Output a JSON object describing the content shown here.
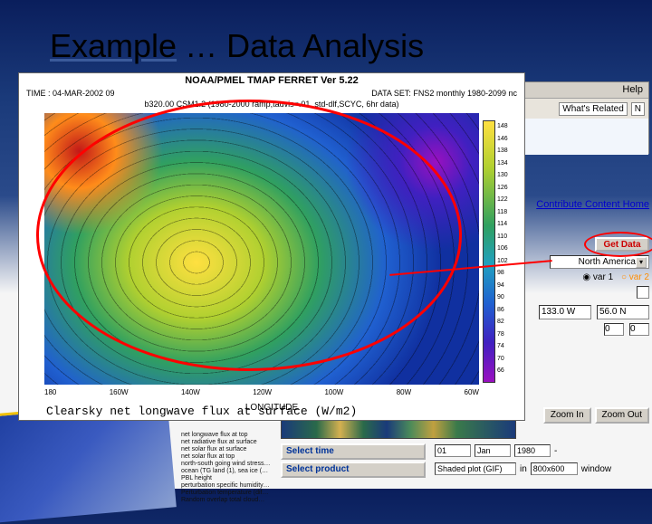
{
  "title_a": "Example",
  "title_b": "… Data Analysis",
  "browser": {
    "help": "Help",
    "related": "What's Related",
    "n": "N"
  },
  "links": {
    "contribute": "Contribute Content",
    "home": "Home"
  },
  "controls": {
    "getdata": "Get Data",
    "region": "North America",
    "var1": "var 1",
    "var2": "var 2",
    "lon": "133.0 W",
    "lat": "56.0 N",
    "box0a": "0",
    "box0b": "0",
    "zoomin": "Zoom In",
    "zoomout": "Zoom Out",
    "seltime": "Select time",
    "selprod": "Select product",
    "t_day": "01",
    "t_mon": "Jan",
    "t_year": "1980",
    "prod": "Shaded plot (GIF)",
    "in": "in",
    "size": "800x600",
    "window": "window"
  },
  "ferret": {
    "header": "NOAA/PMEL TMAP      FERRET Ver 5.22",
    "time": "TIME : 04-MAR-2002 09",
    "dataset": "DATA SET: FNS2 monthly 1980-2099 nc",
    "sub2": "b320.00 CSM1.2 (1980-2000 ramp,tauvis=.01, std-dlf,SCYC, 6hr data)",
    "xlabel": "LONGITUDE",
    "desc": "Clearsky net longwave flux at surface (W/m2)",
    "xticks": [
      "180",
      "160W",
      "140W",
      "120W",
      "100W",
      "80W",
      "60W"
    ],
    "cb": [
      "148",
      "146",
      "138",
      "134",
      "130",
      "126",
      "122",
      "118",
      "114",
      "110",
      "106",
      "102",
      "98",
      "94",
      "90",
      "86",
      "82",
      "78",
      "74",
      "70",
      "66"
    ]
  },
  "varlist": [
    "net longwave flux at top",
    "net radiative flux at surface",
    "net solar flux at surface",
    "net solar flux at top",
    "north-south going wind stress…",
    "ocean (TG land (1), sea ice (…",
    "PBL height",
    "perturbation specific humidity…",
    "Perturbation temperature (dif…",
    "Random overlap total cloud…"
  ]
}
